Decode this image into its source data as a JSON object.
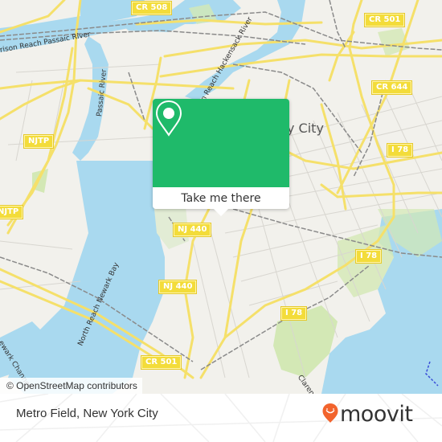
{
  "map": {
    "city_label": "y City",
    "water_labels": [
      "rison Reach Passaic River",
      "Passaic River",
      "on Reach Hackensack River",
      "North Reach Newark Bay",
      "ewark Channel",
      "Claren"
    ],
    "shields": {
      "cr508": "CR 508",
      "cr501_top": "CR 501",
      "cr644": "CR 644",
      "njtp_1": "NJTP",
      "njtp_2": "NJTP",
      "i78_1": "I 78",
      "i78_2": "I 78",
      "i78_3": "I 78",
      "nj440_1": "NJ 440",
      "nj440_2": "NJ 440",
      "cr501_bottom": "CR 501"
    },
    "attribution": "© OpenStreetMap contributors",
    "colors": {
      "land": "#f2f1ec",
      "water": "#a9d9ef",
      "park": "#d3e8b5",
      "road_major": "#f5e06a",
      "rail": "#8a8a8a",
      "popup_green": "#1fba6a"
    }
  },
  "popup": {
    "icon": "location-pin-icon",
    "cta_label": "Take me there"
  },
  "footer": {
    "place_name": "Metro Field, New York City",
    "logo_text": "moovit",
    "logo_icon": "moovit-pin-icon",
    "logo_color": "#f2642d"
  }
}
